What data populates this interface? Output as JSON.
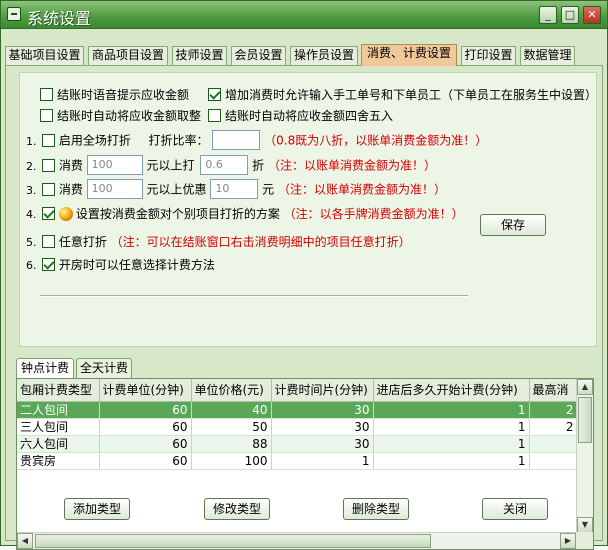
{
  "window": {
    "title": "系统设置",
    "buttons": {
      "minimize": "_",
      "maximize": "□",
      "close": "✕"
    }
  },
  "tabs": [
    "基础项目设置",
    "商品项目设置",
    "技师设置",
    "会员设置",
    "操作员设置",
    "消费、计费设置",
    "打印设置",
    "数据管理"
  ],
  "active_tab": "消费、计费设置",
  "settings": {
    "opt_voice": {
      "label": "结账时语音提示应收金额",
      "checked": false
    },
    "opt_manual_no": {
      "label": "增加消费时允许输入手工单号和下单员工（下单员工在服务生中设置）",
      "checked": true
    },
    "opt_round_jiao": {
      "label": "结账时自动将应收金额取整",
      "checked": false
    },
    "opt_round_45": {
      "label": "结账时自动将应收金额四舍五入",
      "checked": false
    },
    "item1": {
      "num": "1.",
      "label": "启用全场打折",
      "rate_label": "打折比率：",
      "rate_value": "",
      "note": "（0.8既为八折，以账单消费金额为准！）",
      "checked": false
    },
    "item2": {
      "num": "2.",
      "label": "消费",
      "amount": "100",
      "mid": "元以上打",
      "discount": "0.6",
      "unit": "折",
      "note": "（注：以账单消费金额为准！）",
      "checked": false
    },
    "item3": {
      "num": "3.",
      "label": "消费",
      "amount": "100",
      "mid": "元以上优惠",
      "discount": "10",
      "unit": "元",
      "note": "（注：以账单消费金额为准！）",
      "checked": false
    },
    "item4": {
      "num": "4.",
      "label": "设置按消费金额对个别项目打折的方案",
      "note": "（注：以各手牌消费金额为准！）",
      "checked": true
    },
    "item5": {
      "num": "5.",
      "label": "任意打折",
      "note": "（注：可以在结账窗口右击消费明细中的项目任意打折）",
      "checked": false
    },
    "item6": {
      "num": "6.",
      "label": "开房时可以任意选择计费方法",
      "checked": true
    },
    "save_label": "保存"
  },
  "billing_tabs": [
    "钟点计费",
    "全天计费"
  ],
  "grid": {
    "columns": [
      "包厢计费类型",
      "计费单位(分钟)",
      "单位价格(元)",
      "计费时间片(分钟)",
      "进店后多久开始计费(分钟)",
      "最高消"
    ],
    "rows": [
      [
        "二人包间",
        "60",
        "40",
        "30",
        "1",
        "2"
      ],
      [
        "三人包间",
        "60",
        "50",
        "30",
        "1",
        "2"
      ],
      [
        "六人包间",
        "60",
        "88",
        "30",
        "1",
        ""
      ],
      [
        "贵宾房",
        "60",
        "100",
        "1",
        "1",
        ""
      ]
    ],
    "selected_row": 0
  },
  "bottom_buttons": {
    "add": "添加类型",
    "edit": "修改类型",
    "delete": "删除类型",
    "close": "关闭"
  },
  "colors": {
    "title_bar": "#4c9a3e",
    "panel": "#d6e8c8",
    "active_tab": "#f1c89a",
    "selected_row": "#5aa857",
    "note_red": "#d40000"
  }
}
